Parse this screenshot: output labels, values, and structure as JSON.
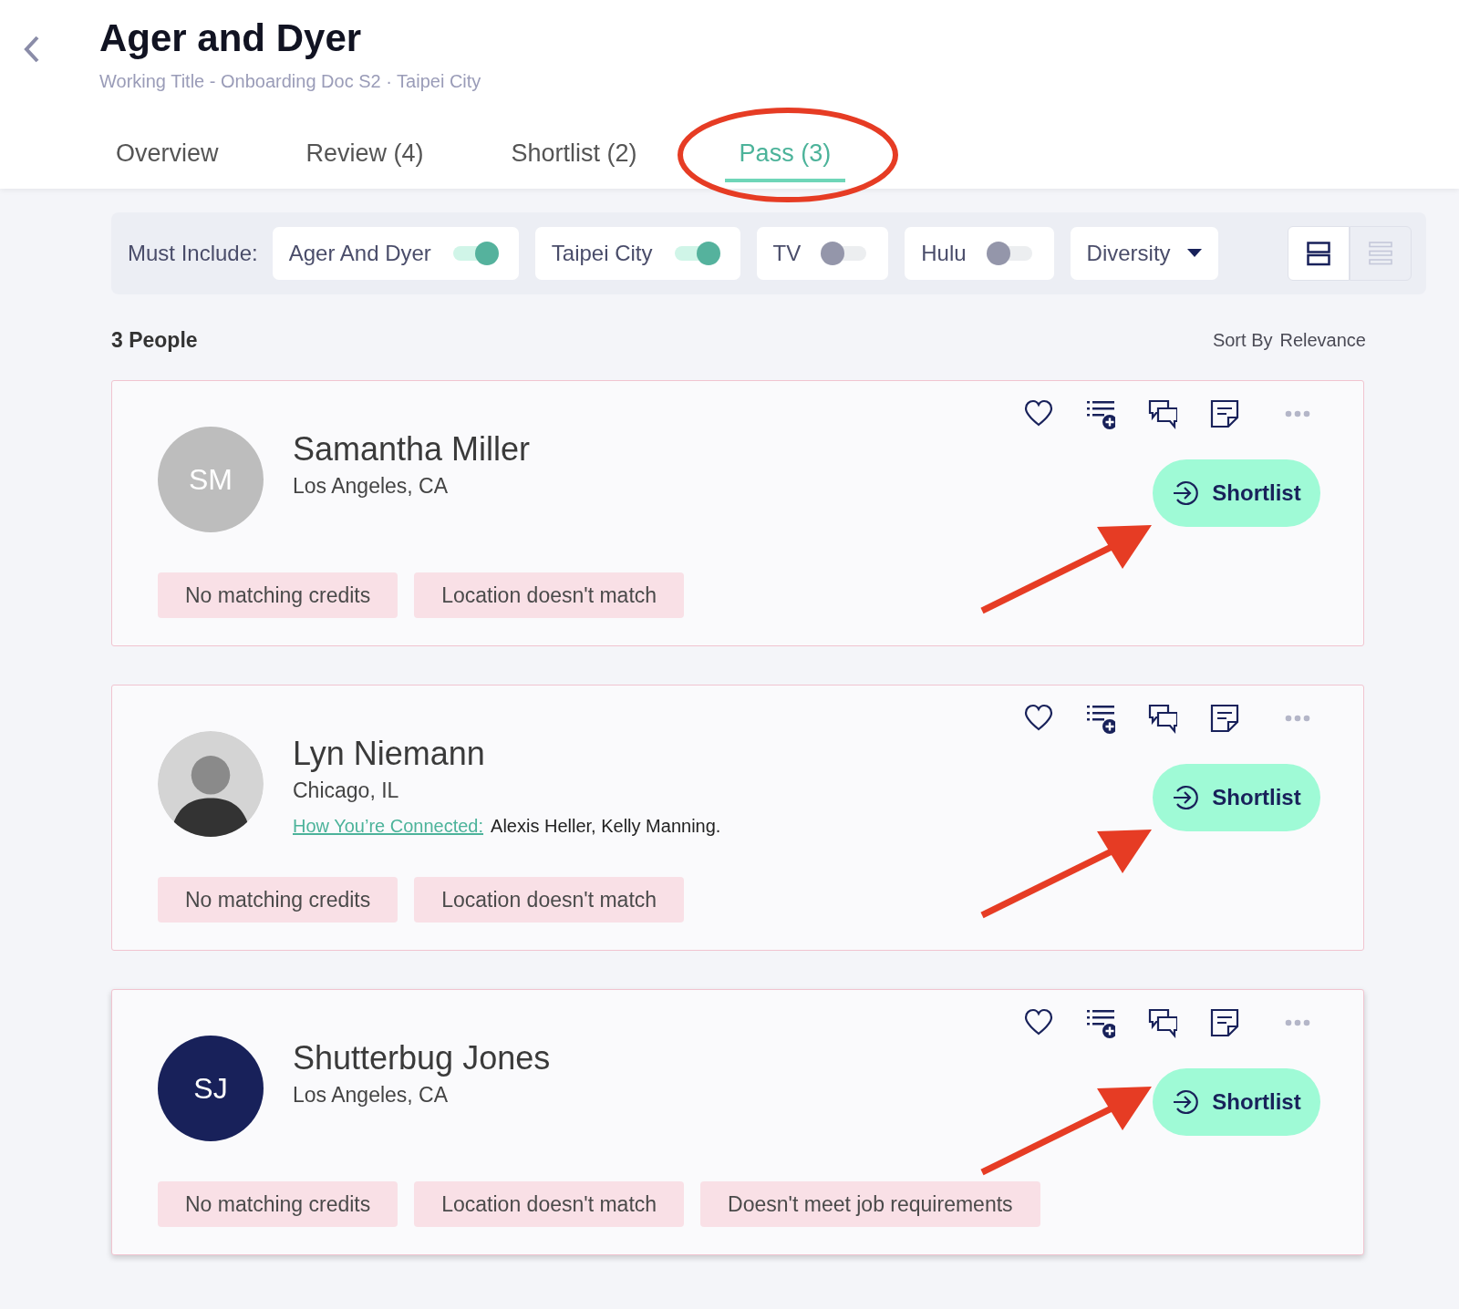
{
  "header": {
    "title": "Ager and Dyer",
    "subtitle": "Working Title - Onboarding Doc S2 · Taipei City"
  },
  "tabs": [
    {
      "label": "Overview",
      "selected": false
    },
    {
      "label": "Review (4)",
      "selected": false
    },
    {
      "label": "Shortlist (2)",
      "selected": false
    },
    {
      "label": "Pass (3)",
      "selected": true
    }
  ],
  "filters": {
    "label": "Must Include:",
    "items": [
      {
        "kind": "toggle",
        "label": "Ager And Dyer",
        "on": true
      },
      {
        "kind": "toggle",
        "label": "Taipei City",
        "on": true
      },
      {
        "kind": "toggle",
        "label": "TV",
        "on": false
      },
      {
        "kind": "toggle",
        "label": "Hulu",
        "on": false
      },
      {
        "kind": "dropdown",
        "label": "Diversity"
      }
    ],
    "views": [
      {
        "kind": "cards",
        "selected": true
      },
      {
        "kind": "list",
        "selected": false
      }
    ]
  },
  "results": {
    "count": "3 People",
    "sort_label": "Sort By",
    "sort_value": "Relevance"
  },
  "people": [
    {
      "name": "Samantha Miller",
      "location": "Los Angeles, CA",
      "avatar": {
        "kind": "initials",
        "initials": "SM",
        "color": "#bdbdbd"
      },
      "action": "Shortlist",
      "tags": [
        "No matching credits",
        "Location doesn't match"
      ]
    },
    {
      "name": "Lyn Niemann",
      "location": "Chicago, IL",
      "avatar": {
        "kind": "photo"
      },
      "connection_link": "How You’re Connected:",
      "connection_names": "Alexis Heller, Kelly Manning.",
      "action": "Shortlist",
      "tags": [
        "No matching credits",
        "Location doesn't match"
      ]
    },
    {
      "name": "Shutterbug Jones",
      "location": "Los Angeles, CA",
      "avatar": {
        "kind": "initials",
        "initials": "SJ",
        "color": "#18215a"
      },
      "action": "Shortlist",
      "tags": [
        "No matching credits",
        "Location doesn't match",
        "Doesn't meet job requirements"
      ]
    }
  ]
}
